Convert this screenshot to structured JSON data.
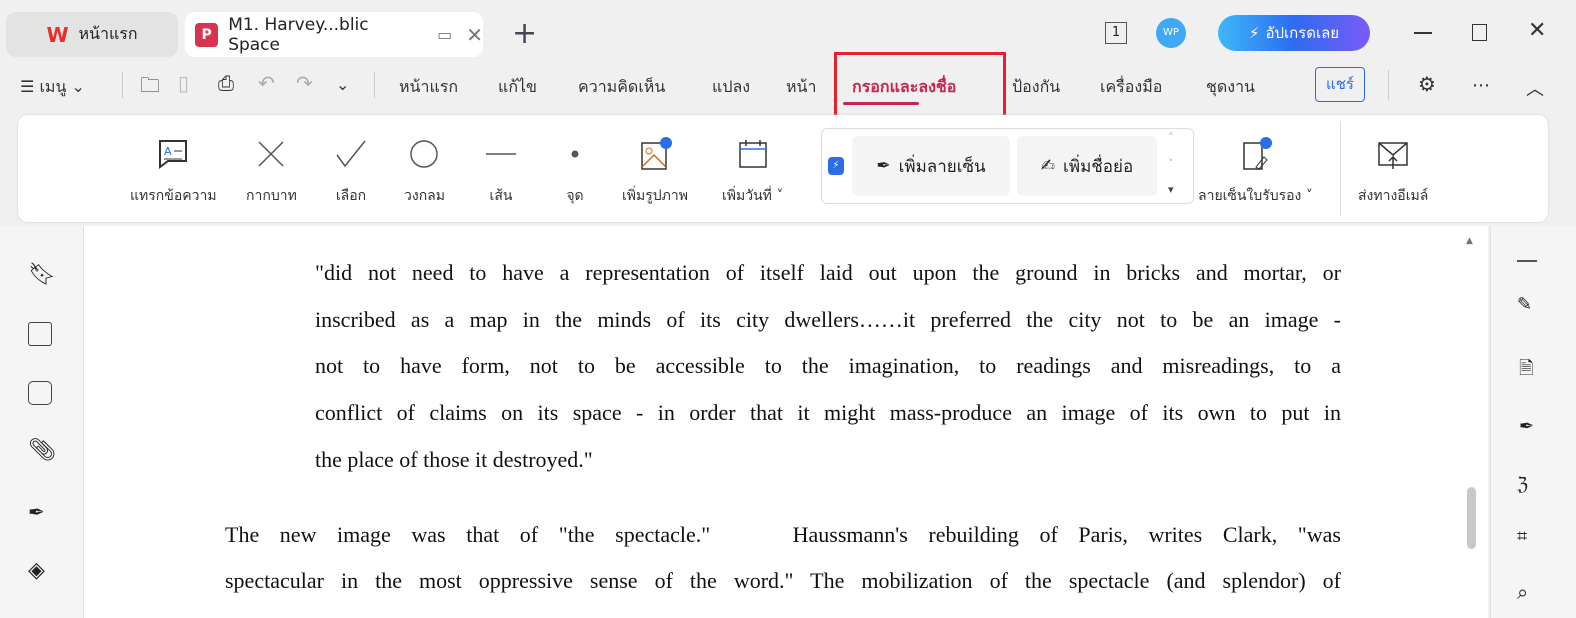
{
  "tabs": {
    "home": "หน้าแรก",
    "doc": "M1. Harvey...blic Space",
    "new": "+"
  },
  "titlebar": {
    "page_badge": "1",
    "avatar": "WP",
    "upgrade": "อัปเกรดเลย"
  },
  "toolbar": {
    "menu": "เมนู",
    "share": "แชร์",
    "active_tab": "กรอกและลงชื่อ",
    "tabs": [
      "หน้าแรก",
      "แก้ไข",
      "ความคิดเห็น",
      "แปลง",
      "หน้า",
      "กรอกและลงชื่อ",
      "ป้องกัน",
      "เครื่องมือ",
      "ชุดงาน"
    ]
  },
  "ribbon": {
    "insert_text": "แทรกข้อความ",
    "cross": "กากบาท",
    "check": "เลือก",
    "circle": "วงกลม",
    "line": "เส้น",
    "dot": "จุด",
    "add_image": "เพิ่มรูปภาพ",
    "add_date": "เพิ่มวันที่",
    "add_signature": "เพิ่มลายเซ็น",
    "add_initials": "เพิ่มชื่อย่อ",
    "cert_signature": "ลายเซ็นใบรับรอง",
    "send_email": "ส่งทางอีเมล์"
  },
  "colors": {
    "accent": "#c7254e",
    "highlight": "#e8202a",
    "share": "#2b6de8"
  },
  "document": {
    "lines": [
      "\"did not need to have a representation of itself laid out upon the ground in bricks and mortar, or",
      "inscribed as a map in the minds of its city dwellers……it preferred the city not to be an image -",
      "not to have form, not to be accessible to the imagination, to readings and misreadings, to a",
      "conflict of claims on its space - in order that it might mass-produce an image of its own to put in",
      "the place of those it destroyed.\"",
      "The new image was that of \"the spectacle.\"    Haussmann's rebuilding of Paris, writes Clark, \"was",
      "spectacular in the most oppressive sense of the word.\" The mobilization of the spectacle (and splendor) of"
    ]
  }
}
